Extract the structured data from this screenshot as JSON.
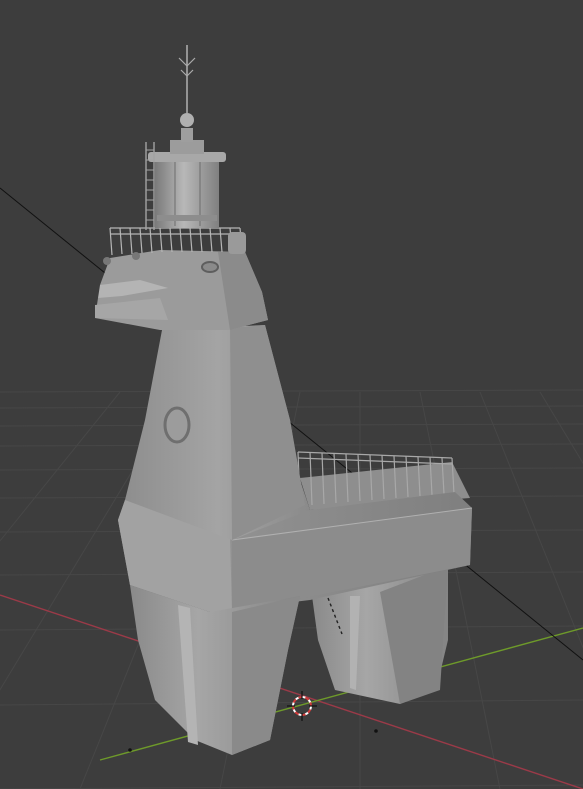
{
  "viewport": {
    "name": "3D Viewport",
    "background_color": "#3d3d3d",
    "grid_color": "#4a4a4a",
    "x_axis_color": "#9b3a48",
    "y_axis_color": "#6e9a2a"
  },
  "scene": {
    "object_name": "lighthouse-llama-model",
    "shading": "solid",
    "base_color": "#9a9a9a"
  },
  "icons": {
    "cursor": "3d-cursor-icon"
  }
}
